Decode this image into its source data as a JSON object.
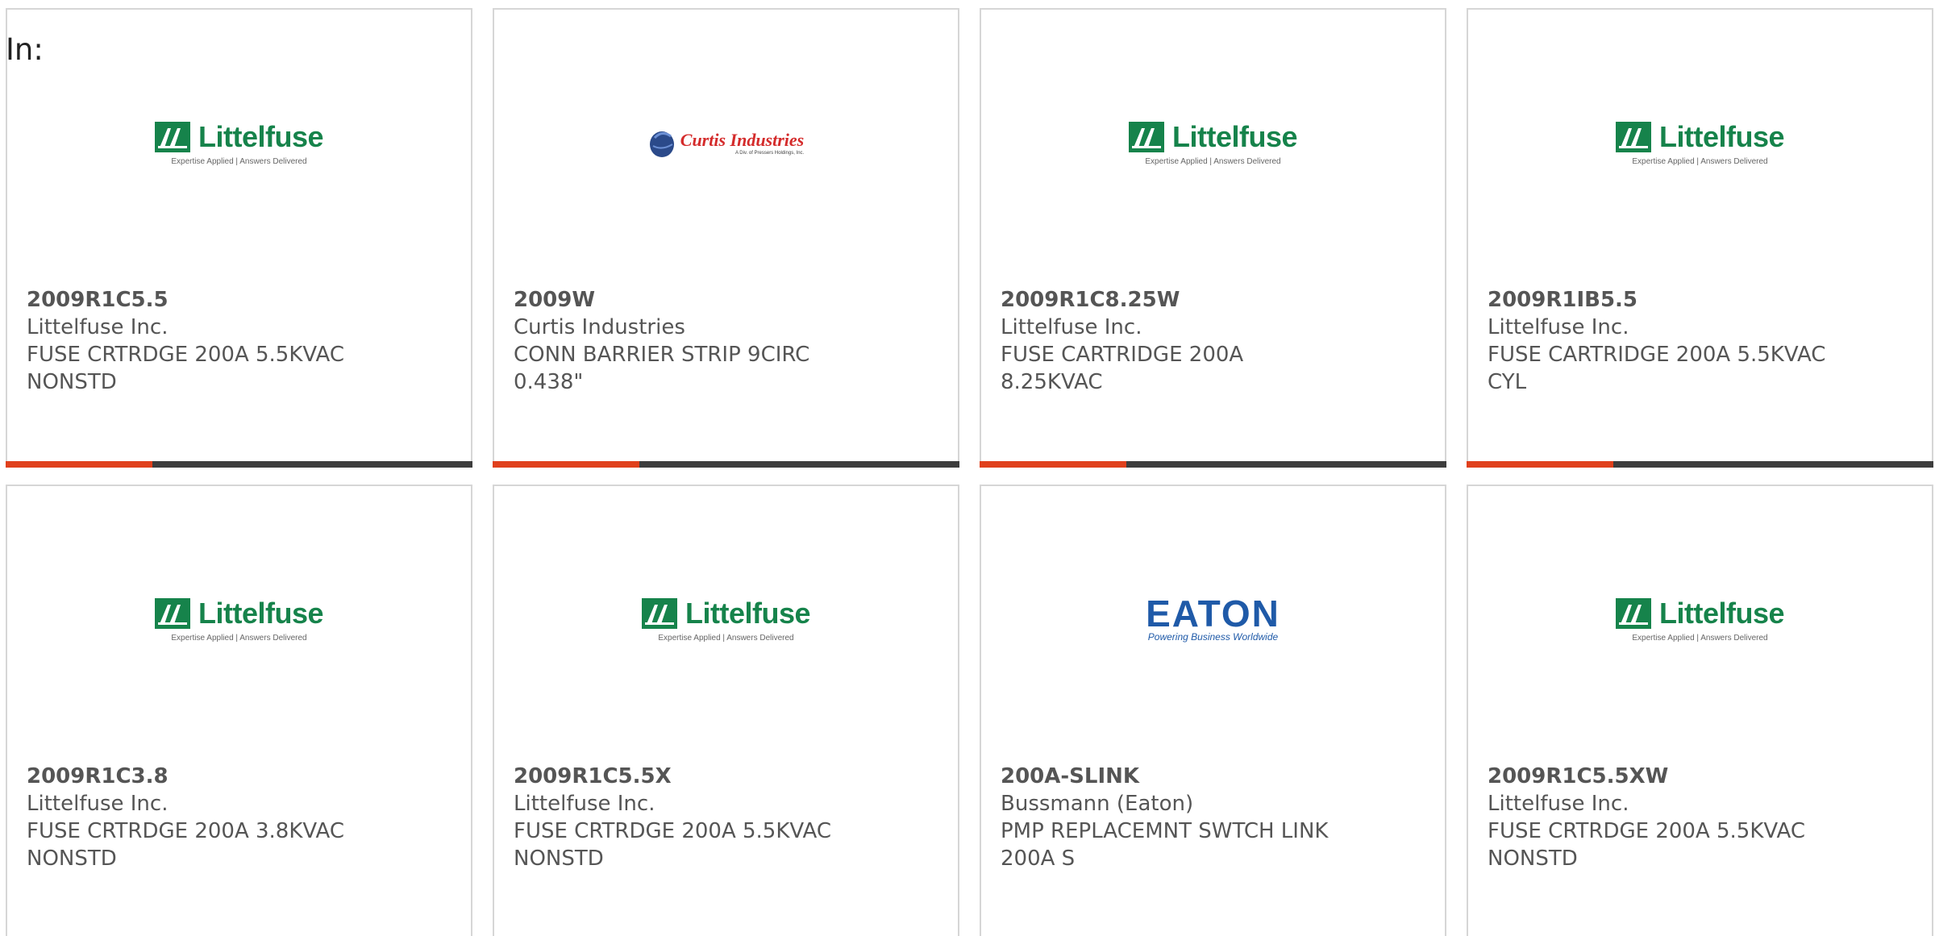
{
  "header": {
    "in_label": "In:"
  },
  "colors": {
    "accent": "#e0401c",
    "bar": "#3d3d3d",
    "border": "#d6d6d6",
    "littelfuse_green": "#16834b",
    "curtis_red": "#d42b2b",
    "eaton_blue": "#1f5aa8"
  },
  "logos": {
    "littelfuse": {
      "name": "Littelfuse",
      "tagline": "Expertise Applied | Answers Delivered"
    },
    "curtis": {
      "name": "Curtis Industries",
      "tagline": "A Div. of Pressers Holdings, Inc."
    },
    "eaton": {
      "name": "EATON",
      "tagline": "Powering Business Worldwide"
    }
  },
  "products": [
    {
      "part": "2009R1C5.5",
      "manufacturer": "Littelfuse Inc.",
      "description_line1": "FUSE CRTRDGE 200A 5.5KVAC",
      "description_line2": "NONSTD",
      "logo": "littelfuse"
    },
    {
      "part": "2009W",
      "manufacturer": "Curtis Industries",
      "description_line1": "CONN BARRIER STRIP 9CIRC",
      "description_line2": "0.438\"",
      "logo": "curtis"
    },
    {
      "part": "2009R1C8.25W",
      "manufacturer": "Littelfuse Inc.",
      "description_line1": "FUSE CARTRIDGE 200A",
      "description_line2": "8.25KVAC",
      "logo": "littelfuse"
    },
    {
      "part": "2009R1IB5.5",
      "manufacturer": "Littelfuse Inc.",
      "description_line1": "FUSE CARTRIDGE 200A 5.5KVAC",
      "description_line2": "CYL",
      "logo": "littelfuse"
    },
    {
      "part": "2009R1C3.8",
      "manufacturer": "Littelfuse Inc.",
      "description_line1": "FUSE CRTRDGE 200A 3.8KVAC",
      "description_line2": "NONSTD",
      "logo": "littelfuse"
    },
    {
      "part": "2009R1C5.5X",
      "manufacturer": "Littelfuse Inc.",
      "description_line1": "FUSE CRTRDGE 200A 5.5KVAC",
      "description_line2": "NONSTD",
      "logo": "littelfuse"
    },
    {
      "part": "200A-SLINK",
      "manufacturer": "Bussmann (Eaton)",
      "description_line1": "PMP REPLACEMNT SWTCH LINK",
      "description_line2": "200A S",
      "logo": "eaton"
    },
    {
      "part": "2009R1C5.5XW",
      "manufacturer": "Littelfuse Inc.",
      "description_line1": "FUSE CRTRDGE 200A 5.5KVAC",
      "description_line2": "NONSTD",
      "logo": "littelfuse"
    }
  ]
}
